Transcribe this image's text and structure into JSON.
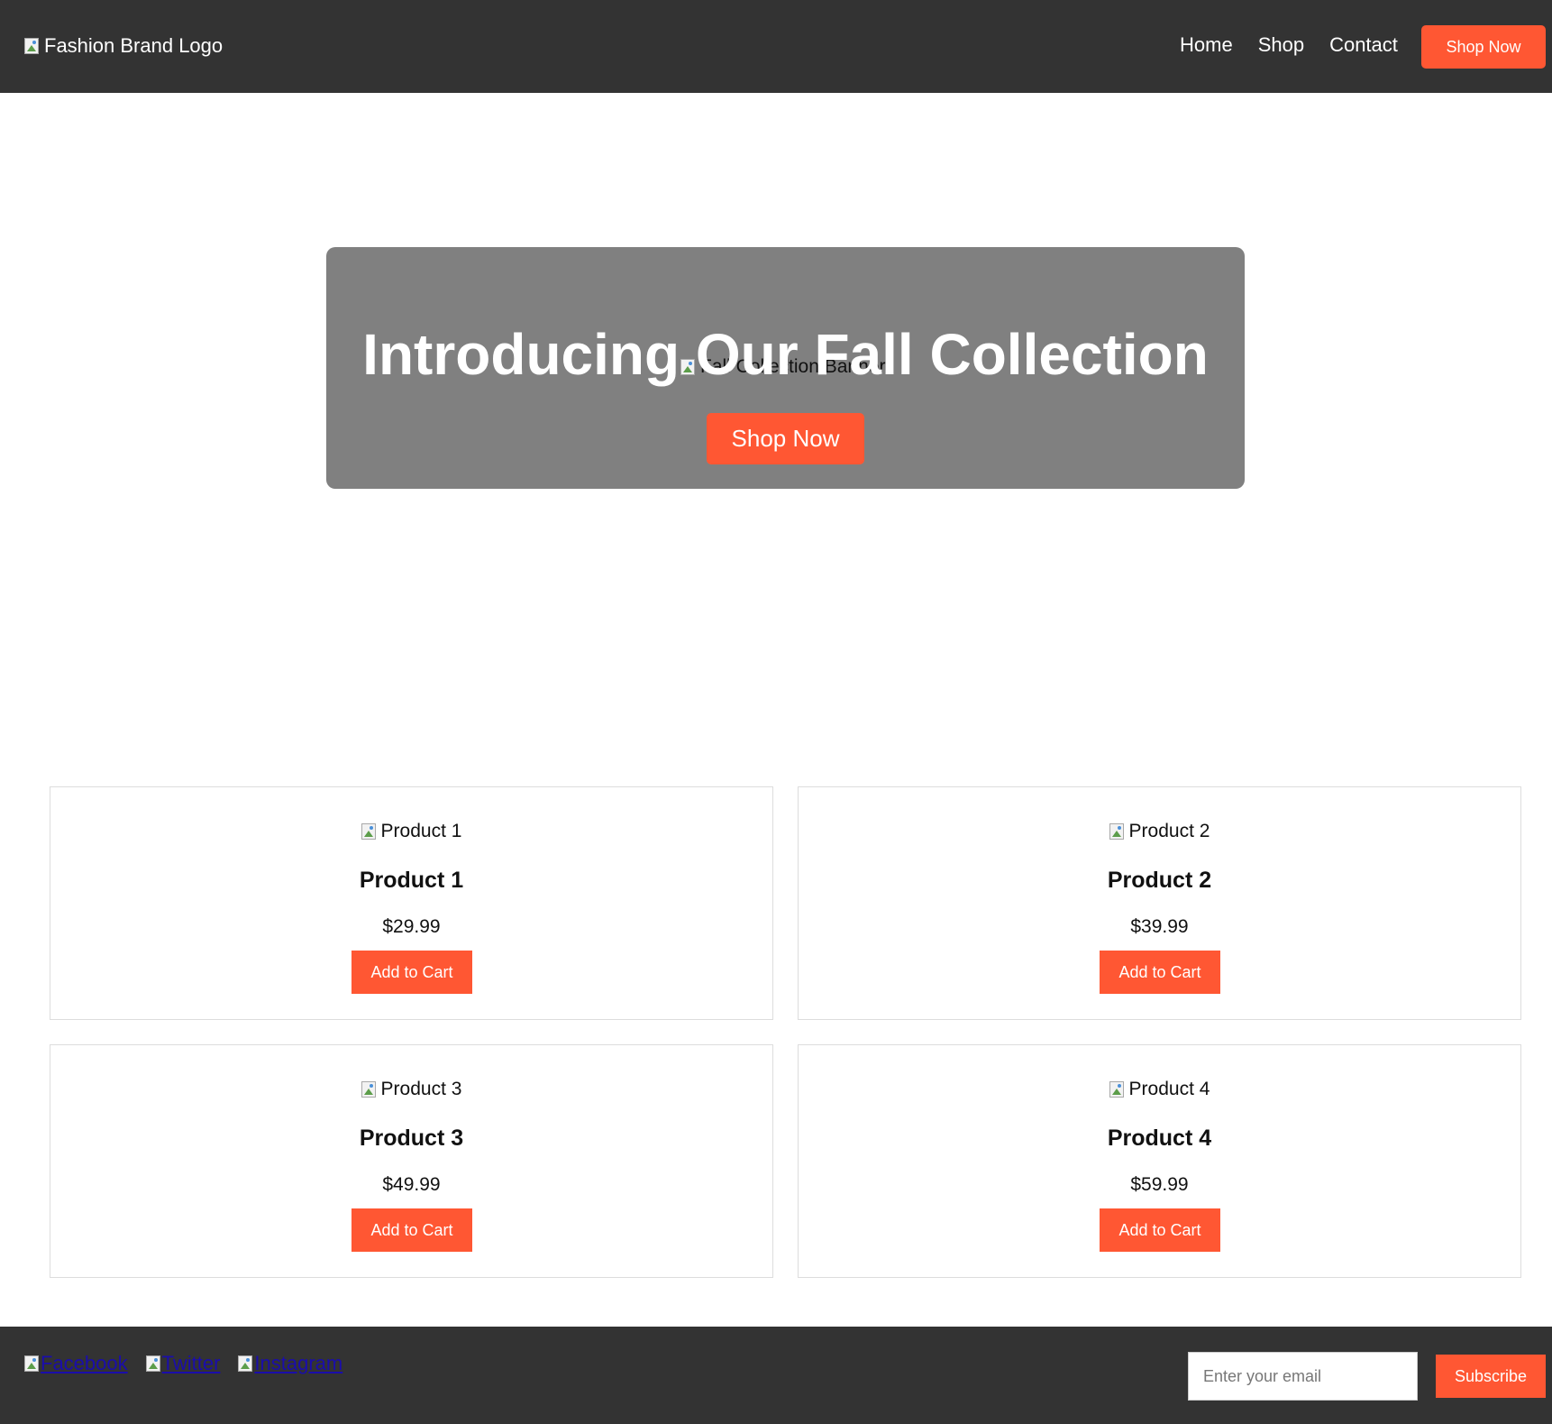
{
  "header": {
    "logo_alt": "Fashion Brand Logo",
    "nav": [
      "Home",
      "Shop",
      "Contact"
    ],
    "cta_label": "Shop Now"
  },
  "hero": {
    "banner_alt": "Fall Collection Banner",
    "title": "Introducing Our Fall Collection",
    "button_label": "Shop Now"
  },
  "products": [
    {
      "image_alt": "Product 1",
      "name": "Product 1",
      "price": "$29.99",
      "button_label": "Add to Cart"
    },
    {
      "image_alt": "Product 2",
      "name": "Product 2",
      "price": "$39.99",
      "button_label": "Add to Cart"
    },
    {
      "image_alt": "Product 3",
      "name": "Product 3",
      "price": "$49.99",
      "button_label": "Add to Cart"
    },
    {
      "image_alt": "Product 4",
      "name": "Product 4",
      "price": "$59.99",
      "button_label": "Add to Cart"
    }
  ],
  "footer": {
    "social": [
      "Facebook",
      "Twitter",
      "Instagram"
    ],
    "email_placeholder": "Enter your email",
    "subscribe_label": "Subscribe"
  },
  "colors": {
    "header_bg": "#333333",
    "accent": "#ff5733",
    "hero_bg": "#808080"
  }
}
